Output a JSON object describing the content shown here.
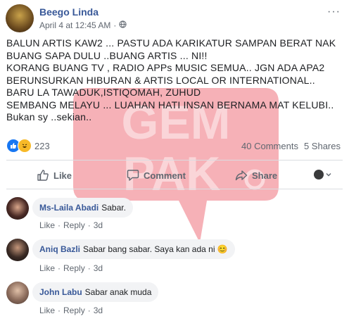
{
  "post": {
    "author": "Beego Linda",
    "timestamp": "April 4 at 12:45 AM",
    "separator": "·",
    "privacy_icon": "public-globe-icon",
    "more_label": "···",
    "text": "BALUN ARTIS KAW2 ... PASTU ADA KARIKATUR SAMPAN BERAT NAK BUANG SAPA DULU ..BUANG ARTIS ... NI!!\nKORANG BUANG TV , RADIO APPs MUSIC SEMUA.. JGN ADA APA2 BERUNSURKAN HIBURAN & ARTIS LOCAL OR INTERNATIONAL.. BARU LA TAWADUK,ISTIQOMAH, ZUHUD\nSEMBANG MELAYU ... LUAHAN HATI INSAN BERNAMA MAT KELUBI.. Bukan sy ..sekian..",
    "reaction_count": "223",
    "comments_count": "40 Comments",
    "shares_count": "5 Shares"
  },
  "actions": {
    "like": "Like",
    "comment": "Comment",
    "share": "Share"
  },
  "watermark": {
    "line1": "GEM",
    "line2": "PAK",
    "color": "#f4a3aa",
    "text_color": "#fbd9dc"
  },
  "colors": {
    "link": "#385898",
    "muted": "#606770",
    "like_blue": "#1877f2",
    "haha_yellow": "#f7b928"
  },
  "comments": [
    {
      "name": "Ms-Laila Abadi",
      "text": "Sabar.",
      "like": "Like",
      "reply": "Reply",
      "dot": "·",
      "time": "3d"
    },
    {
      "name": "Aniq Bazli",
      "text": "Sabar bang sabar. Saya kan ada ni 😊",
      "like": "Like",
      "reply": "Reply",
      "dot": "·",
      "time": "3d"
    },
    {
      "name": "John Labu",
      "text": "Sabar anak muda",
      "like": "Like",
      "reply": "Reply",
      "dot": "·",
      "time": "3d"
    }
  ]
}
